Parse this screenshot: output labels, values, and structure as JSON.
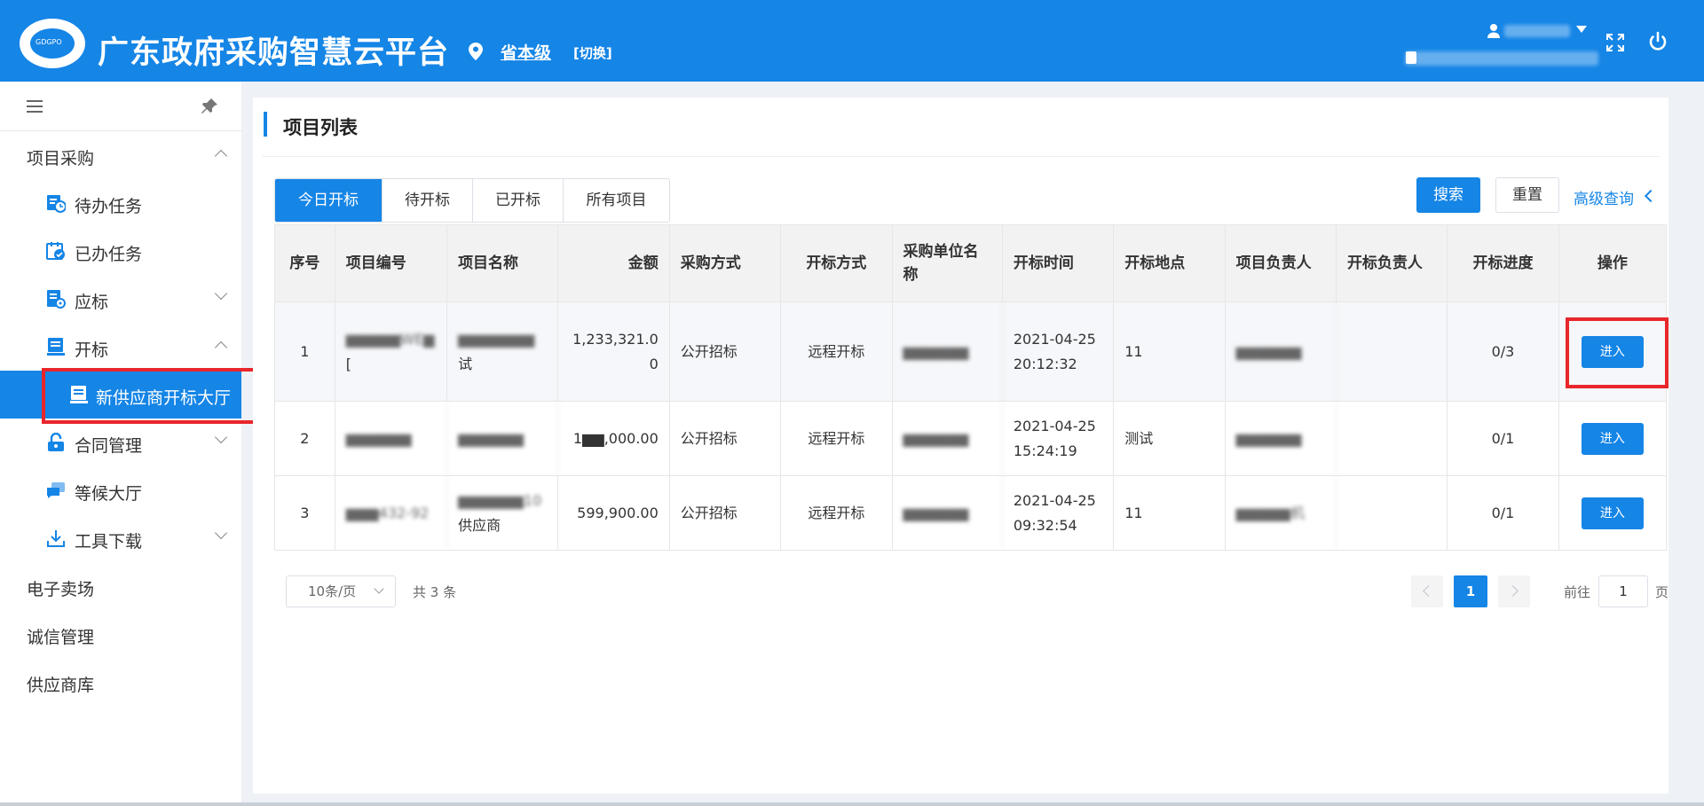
{
  "header": {
    "title": "广东政府采购智慧云平台",
    "region": "省本级",
    "switch_label": "[切换]",
    "colors": {
      "brand": "#1585e6",
      "highlight": "#e8262b"
    }
  },
  "sidebar": {
    "groups": [
      {
        "label": "项目采购",
        "icon": "chevron-up-icon"
      },
      {
        "label": "电子卖场"
      },
      {
        "label": "诚信管理"
      },
      {
        "label": "供应商库"
      }
    ],
    "items": [
      {
        "label": "待办任务",
        "icon": "todo-clock-icon"
      },
      {
        "label": "已办任务",
        "icon": "done-check-icon"
      },
      {
        "label": "应标",
        "icon": "bid-doc-icon"
      },
      {
        "label": "开标",
        "icon": "open-bid-icon"
      },
      {
        "label": "新供应商开标大厅",
        "icon": "hall-icon"
      },
      {
        "label": "合同管理",
        "icon": "lock-icon"
      },
      {
        "label": "等候大厅",
        "icon": "chat-icon"
      },
      {
        "label": "工具下载",
        "icon": "download-icon"
      }
    ]
  },
  "main": {
    "page_title": "项目列表",
    "tabs": [
      "今日开标",
      "待开标",
      "已开标",
      "所有项目"
    ],
    "buttons": {
      "search": "搜索",
      "reset": "重置",
      "advanced": "高级查询"
    }
  },
  "table": {
    "headers": [
      "序号",
      "项目编号",
      "项目名称",
      "金额",
      "采购方式",
      "开标方式",
      "采购单位名称",
      "开标时间",
      "开标地点",
      "项目负责人",
      "开标负责人",
      "开标进度",
      "操作"
    ],
    "rows": [
      {
        "no": "1",
        "code": "▆▆▆▆▆WE▆",
        "code2": "[",
        "name": "▆▆▆▆▆▆▆",
        "name2": "试",
        "amount": "1,233,321.00",
        "method": "公开招标",
        "open_method": "远程开标",
        "unit": "▆▆▆▆▆▆",
        "time": "2021-04-25 20:12:32",
        "place": "11",
        "owner": "▆▆▆▆▆▆",
        "open_owner": "",
        "progress": "0/3",
        "action": "进入"
      },
      {
        "no": "2",
        "code": "▆▆▆▆▆▆",
        "code2": "",
        "name": "▆▆▆▆▆▆",
        "name2": "",
        "amount": "1▆▆,000.00",
        "method": "公开招标",
        "open_method": "远程开标",
        "unit": "▆▆▆▆▆▆",
        "time": "2021-04-25 15:24:19",
        "place": "测试",
        "owner": "▆▆▆▆▆▆",
        "open_owner": "",
        "progress": "0/1",
        "action": "进入"
      },
      {
        "no": "3",
        "code": "▆▆▆432-92",
        "code2": "",
        "name": "▆▆▆▆▆▆10",
        "name2": "供应商",
        "amount": "599,900.00",
        "method": "公开招标",
        "open_method": "远程开标",
        "unit": "▆▆▆▆▆▆",
        "time": "2021-04-25 09:32:54",
        "place": "11",
        "owner": "▆▆▆▆▆机",
        "open_owner": "",
        "progress": "0/1",
        "action": "进入"
      }
    ]
  },
  "pagination": {
    "page_size": "10条/页",
    "total": "共 3 条",
    "current_page": "1",
    "goto_label": "前往",
    "goto_value": "1",
    "goto_suffix": "页"
  }
}
